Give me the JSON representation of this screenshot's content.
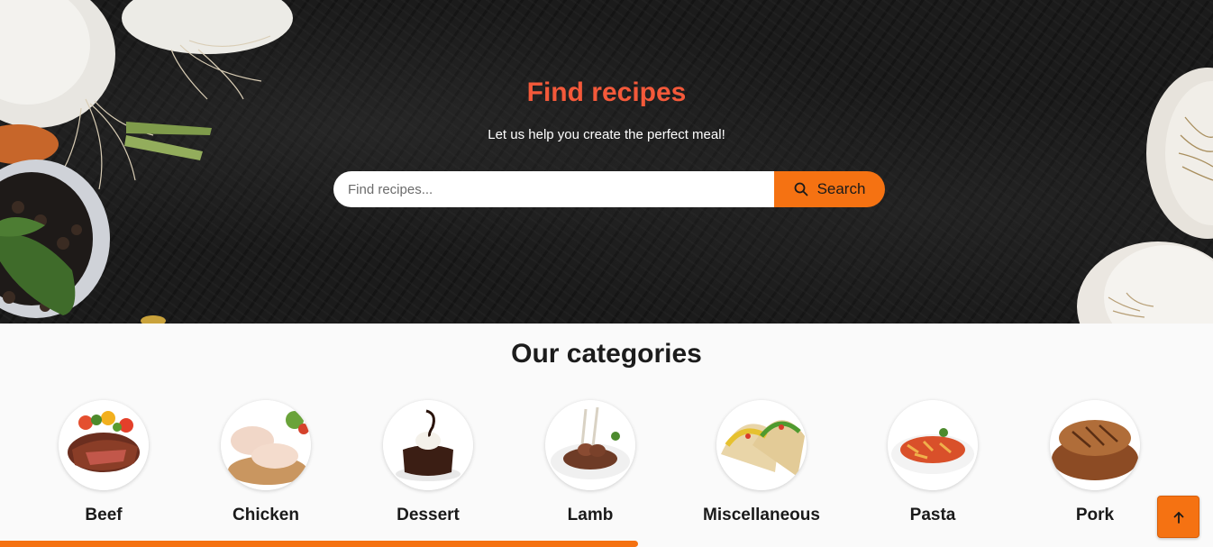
{
  "hero": {
    "title": "Find recipes",
    "subtitle": "Let us help you create the perfect meal!",
    "search": {
      "placeholder": "Find recipes...",
      "value": "",
      "button_label": "Search",
      "icon": "search-icon"
    }
  },
  "categories": {
    "title": "Our categories",
    "items": [
      {
        "label": "Beef",
        "icon": "beef-image"
      },
      {
        "label": "Chicken",
        "icon": "chicken-image"
      },
      {
        "label": "Dessert",
        "icon": "dessert-image"
      },
      {
        "label": "Lamb",
        "icon": "lamb-image"
      },
      {
        "label": "Miscellaneous",
        "icon": "miscellaneous-image"
      },
      {
        "label": "Pasta",
        "icon": "pasta-image"
      },
      {
        "label": "Pork",
        "icon": "pork-image"
      }
    ]
  },
  "scroll_progress": 0.526,
  "back_to_top": {
    "icon": "arrow-up-icon"
  },
  "colors": {
    "accent": "#f57212",
    "title": "#f4593a",
    "hero_bg": "#1b1b1b",
    "page_bg": "#fafafa"
  }
}
